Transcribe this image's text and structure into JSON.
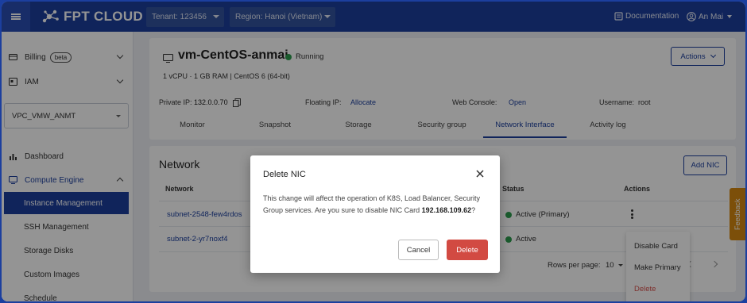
{
  "header": {
    "brand": "FPT CLOUD",
    "tenant": "Tenant: 123456",
    "region": "Region: Hanoi (Vietnam)",
    "documentation": "Documentation",
    "user": "An Mai"
  },
  "sidebar": {
    "billing": "Billing",
    "billing_badge": "beta",
    "iam": "IAM",
    "vpc": "VPC_VMW_ANMT",
    "dashboard": "Dashboard",
    "compute_engine": "Compute Engine",
    "items": [
      {
        "label": "Instance Management"
      },
      {
        "label": "SSH Management"
      },
      {
        "label": "Storage Disks"
      },
      {
        "label": "Custom Images"
      },
      {
        "label": "Schedule"
      }
    ]
  },
  "vm": {
    "name": "vm-CentOS-anmai",
    "status": "Running",
    "spec": "1 vCPU · 1 GB RAM | CentOS 6 (64-bit)",
    "actions_label": "Actions",
    "private_ip_label": "Private IP:",
    "private_ip": "132.0.0.70",
    "floating_ip_label": "Floating IP:",
    "floating_ip_action": "Allocate",
    "web_console_label": "Web Console:",
    "web_console_action": "Open",
    "username_label": "Username:",
    "username": "root"
  },
  "tabs": [
    {
      "label": "Monitor"
    },
    {
      "label": "Snapshot"
    },
    {
      "label": "Storage"
    },
    {
      "label": "Security group"
    },
    {
      "label": "Network Interface"
    },
    {
      "label": "Activity log"
    }
  ],
  "network": {
    "title": "Network",
    "add_nic": "Add NIC",
    "columns": {
      "network": "Network",
      "status": "Status",
      "actions": "Actions"
    },
    "rows": [
      {
        "network": "subnet-2548-few4rdos",
        "status": "Active (Primary)"
      },
      {
        "network": "subnet-2-yr7noxf4",
        "status": "Active"
      }
    ],
    "rows_per_page_label": "Rows per page:",
    "rows_per_page": "10"
  },
  "row_menu": {
    "items": [
      "Disable Card",
      "Make Primary",
      "Delete"
    ]
  },
  "feedback": "Feedback",
  "modal": {
    "title": "Delete NIC",
    "body": "This change will affect the operation of K8S, Load Balancer, Security Group services. Are you sure to disable NIC Card",
    "ip": "192.168.109.62",
    "suffix": "?",
    "cancel": "Cancel",
    "delete": "Delete"
  },
  "colors": {
    "primary": "#1c3f9e",
    "danger": "#d24a42",
    "success": "#2e9e4f",
    "feedback": "#d68910"
  }
}
